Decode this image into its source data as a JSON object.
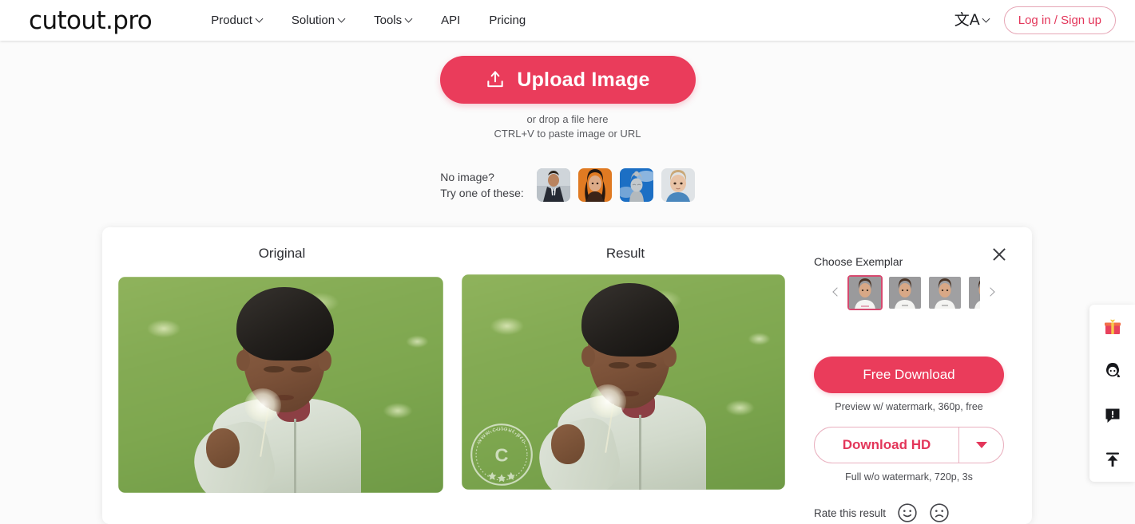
{
  "header": {
    "logo": "cutout.pro",
    "nav": [
      {
        "label": "Product",
        "has_chevron": true
      },
      {
        "label": "Solution",
        "has_chevron": true
      },
      {
        "label": "Tools",
        "has_chevron": true
      },
      {
        "label": "API",
        "has_chevron": false
      },
      {
        "label": "Pricing",
        "has_chevron": false
      }
    ],
    "language_glyph": "文A",
    "login_label": "Log in / Sign up"
  },
  "upload": {
    "button_label": "Upload Image",
    "icon": "upload-icon",
    "drop_hint_1": "or drop a file here",
    "drop_hint_2": "CTRL+V to paste image or URL"
  },
  "samples": {
    "line1": "No image?",
    "line2": "Try one of these:",
    "thumbnails": [
      {
        "name": "sample-man-suit"
      },
      {
        "name": "sample-woman-orange"
      },
      {
        "name": "sample-statue-sky"
      },
      {
        "name": "sample-baby"
      }
    ]
  },
  "card": {
    "original_title": "Original",
    "result_title": "Result",
    "watermark_text": "www.cutout.pro",
    "watermark_mark": "C"
  },
  "panel": {
    "exemplar_title": "Choose Exemplar",
    "close_icon": "close-icon",
    "prev_icon": "chevron-left-icon",
    "next_icon": "chevron-right-icon",
    "exemplars": [
      {
        "name": "exemplar-1",
        "selected": true
      },
      {
        "name": "exemplar-2",
        "selected": false
      },
      {
        "name": "exemplar-3",
        "selected": false
      },
      {
        "name": "exemplar-4",
        "selected": false
      }
    ],
    "free_download_label": "Free Download",
    "free_download_caption": "Preview w/ watermark, 360p, free",
    "download_hd_label": "Download HD",
    "download_hd_caption": "Full w/o watermark, 720p, 3s",
    "dropdown_icon": "caret-down-icon",
    "rate_label": "Rate this result",
    "rate_positive_icon": "smiley-face-icon",
    "rate_negative_icon": "frowny-face-icon"
  },
  "float_toolbar": [
    {
      "name": "gift-icon"
    },
    {
      "name": "support-agent-icon"
    },
    {
      "name": "feedback-icon"
    },
    {
      "name": "scroll-to-top-icon"
    }
  ],
  "colors": {
    "accent": "#ea3c5b",
    "accent_text": "#e3365a",
    "accent_border": "#e9b0bf",
    "page_bg": "#fbfbfb"
  }
}
